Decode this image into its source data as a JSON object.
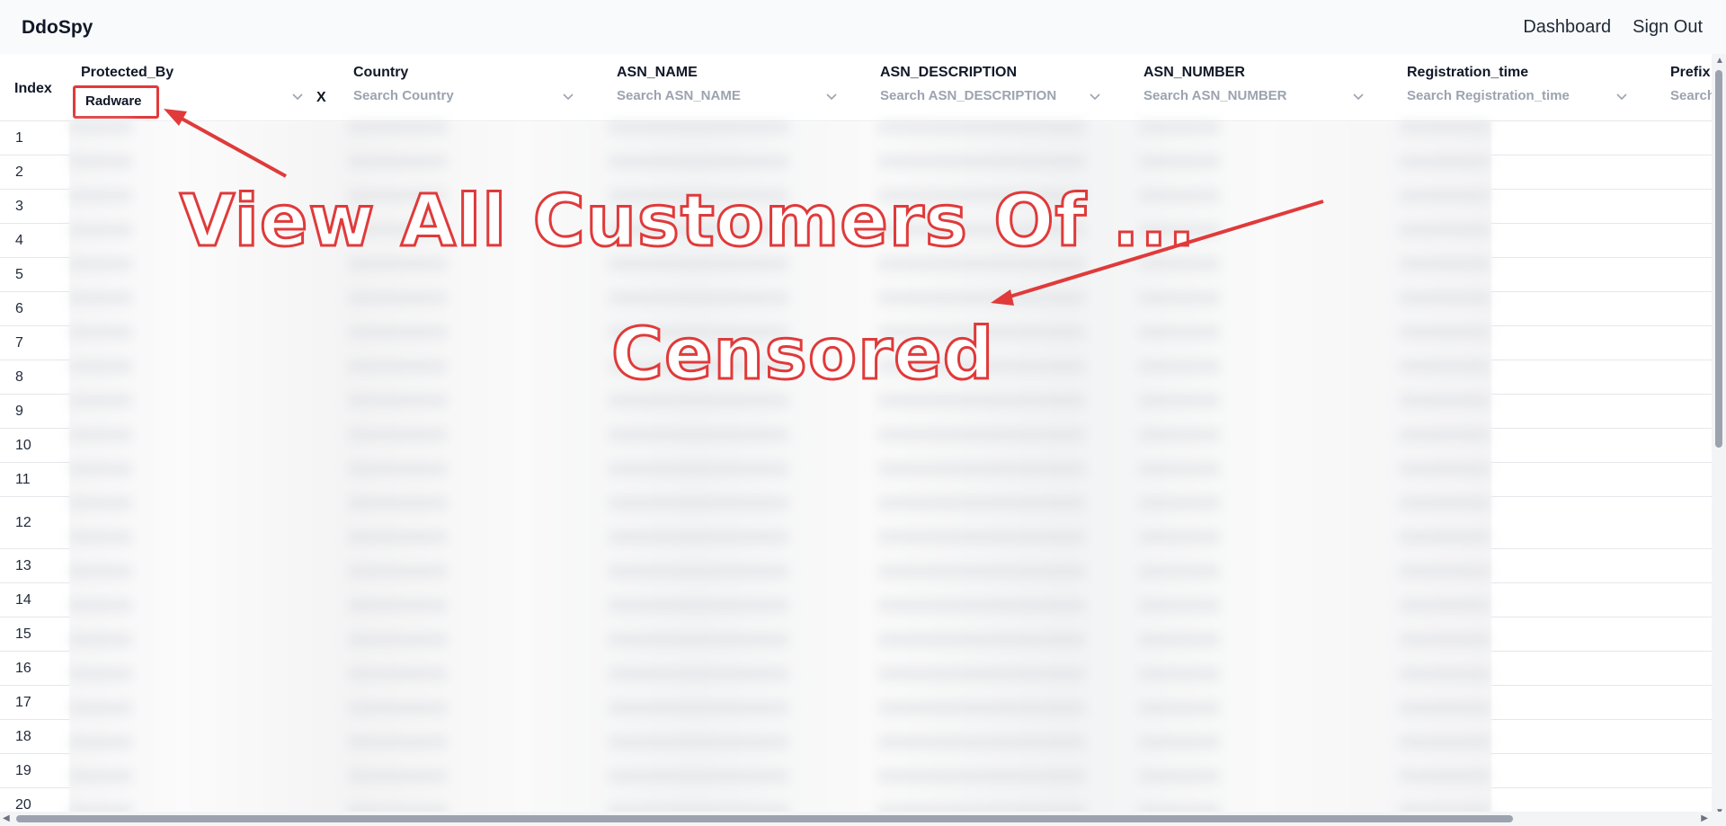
{
  "app": {
    "brand": "DdoSpy"
  },
  "nav": {
    "dashboard": "Dashboard",
    "sign_out": "Sign Out"
  },
  "table": {
    "index_header": "Index",
    "columns": [
      {
        "title": "Protected_By",
        "placeholder": ""
      },
      {
        "title": "Country",
        "placeholder": "Search Country"
      },
      {
        "title": "ASN_NAME",
        "placeholder": "Search ASN_NAME"
      },
      {
        "title": "ASN_DESCRIPTION",
        "placeholder": "Search ASN_DESCRIPTION"
      },
      {
        "title": "ASN_NUMBER",
        "placeholder": "Search ASN_NUMBER"
      },
      {
        "title": "Registration_time",
        "placeholder": "Search Registration_time"
      },
      {
        "title": "Prefix",
        "placeholder": "Search"
      }
    ],
    "protected_by_selected": "Radware",
    "clear_filter": "X",
    "row_indices": [
      "1",
      "2",
      "3",
      "4",
      "5",
      "6",
      "7",
      "8",
      "9",
      "10",
      "11",
      "12",
      "13",
      "14",
      "15",
      "16",
      "17",
      "18",
      "19",
      "20"
    ]
  },
  "annotations": {
    "line1": "View All Customers Of ...",
    "line2": "Censored",
    "color": "#e03a3a"
  }
}
